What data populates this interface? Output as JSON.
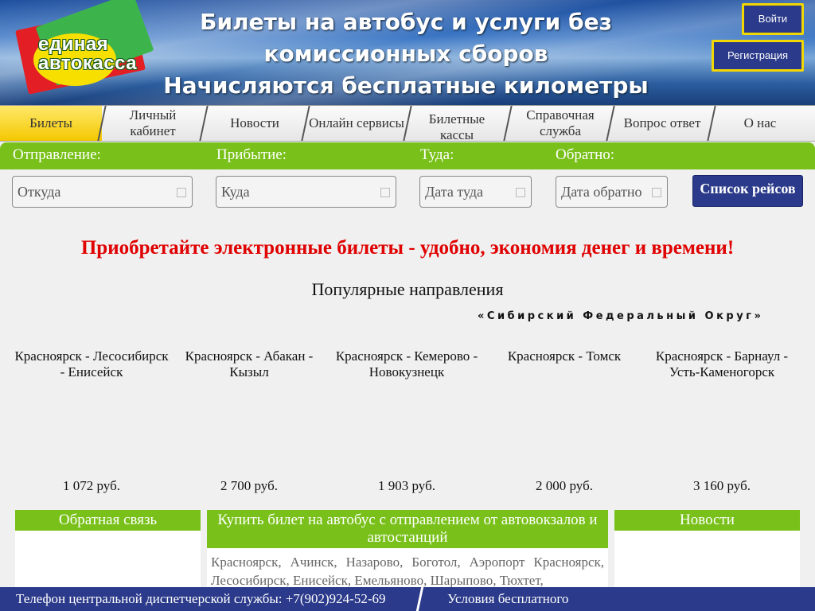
{
  "header": {
    "logo_line1": "единая",
    "logo_line2": "автокасса",
    "title_line1": "Билеты на автобус и услуги без",
    "title_line2": "комиссионных сборов",
    "title_line3": "Начисляются бесплатные километры",
    "login_label": "Войти",
    "register_label": "Регистрация"
  },
  "nav": {
    "items": [
      {
        "label": "Билеты"
      },
      {
        "label": "Личный кабинет"
      },
      {
        "label": "Новости"
      },
      {
        "label": "Онлайн сервисы"
      },
      {
        "label": "Билетные кассы"
      },
      {
        "label": "Справочная служба"
      },
      {
        "label": "Вопрос ответ"
      },
      {
        "label": "О нас"
      }
    ]
  },
  "search": {
    "from_label": "Отправление:",
    "to_label": "Прибытие:",
    "there_label": "Туда:",
    "back_label": "Обратно:",
    "from_placeholder": "Откуда",
    "to_placeholder": "Куда",
    "there_placeholder": "Дата туда",
    "back_placeholder": "Дата обратно",
    "button_label": "Список рейсов"
  },
  "promo_text": "Приобретайте электронные билеты - удобно, экономия денег и времени!",
  "popular": {
    "title": "Популярные направления",
    "district": "«Сибирский Федеральный Округ»",
    "routes": [
      {
        "name": "Красноярск - Лесосибирск - Енисейск",
        "price": "1 072 руб."
      },
      {
        "name": "Красноярск - Абакан - Кызыл",
        "price": "2 700 руб."
      },
      {
        "name": "Красноярск - Кемерово - Новокузнецк",
        "price": "1 903 руб."
      },
      {
        "name": "Красноярск - Томск",
        "price": "2 000 руб."
      },
      {
        "name": "Красноярск - Барнаул - Усть-Каменогорск",
        "price": "3 160 руб."
      }
    ]
  },
  "panels": {
    "feedback_title": "Обратная связь",
    "buy_title": "Купить билет на автобус с отправлением от автовокзалов и автостанций",
    "buy_text": "Красноярск, Ачинск, Назарово, Боготол, Аэропорт Красноярск, Лесосибирск, Енисейск, Емельяново, Шарыпово, Тюхтет,",
    "news_title": "Новости"
  },
  "footer": {
    "phone_text": "Телефон центральной диспетчерской службы: +7(902)924-52-69",
    "terms_text": "Условия бесплатного"
  },
  "colors": {
    "green": "#79c11a",
    "navy": "#2b3a8a",
    "yellow": "#f2d700",
    "promo_red": "#e00000"
  }
}
